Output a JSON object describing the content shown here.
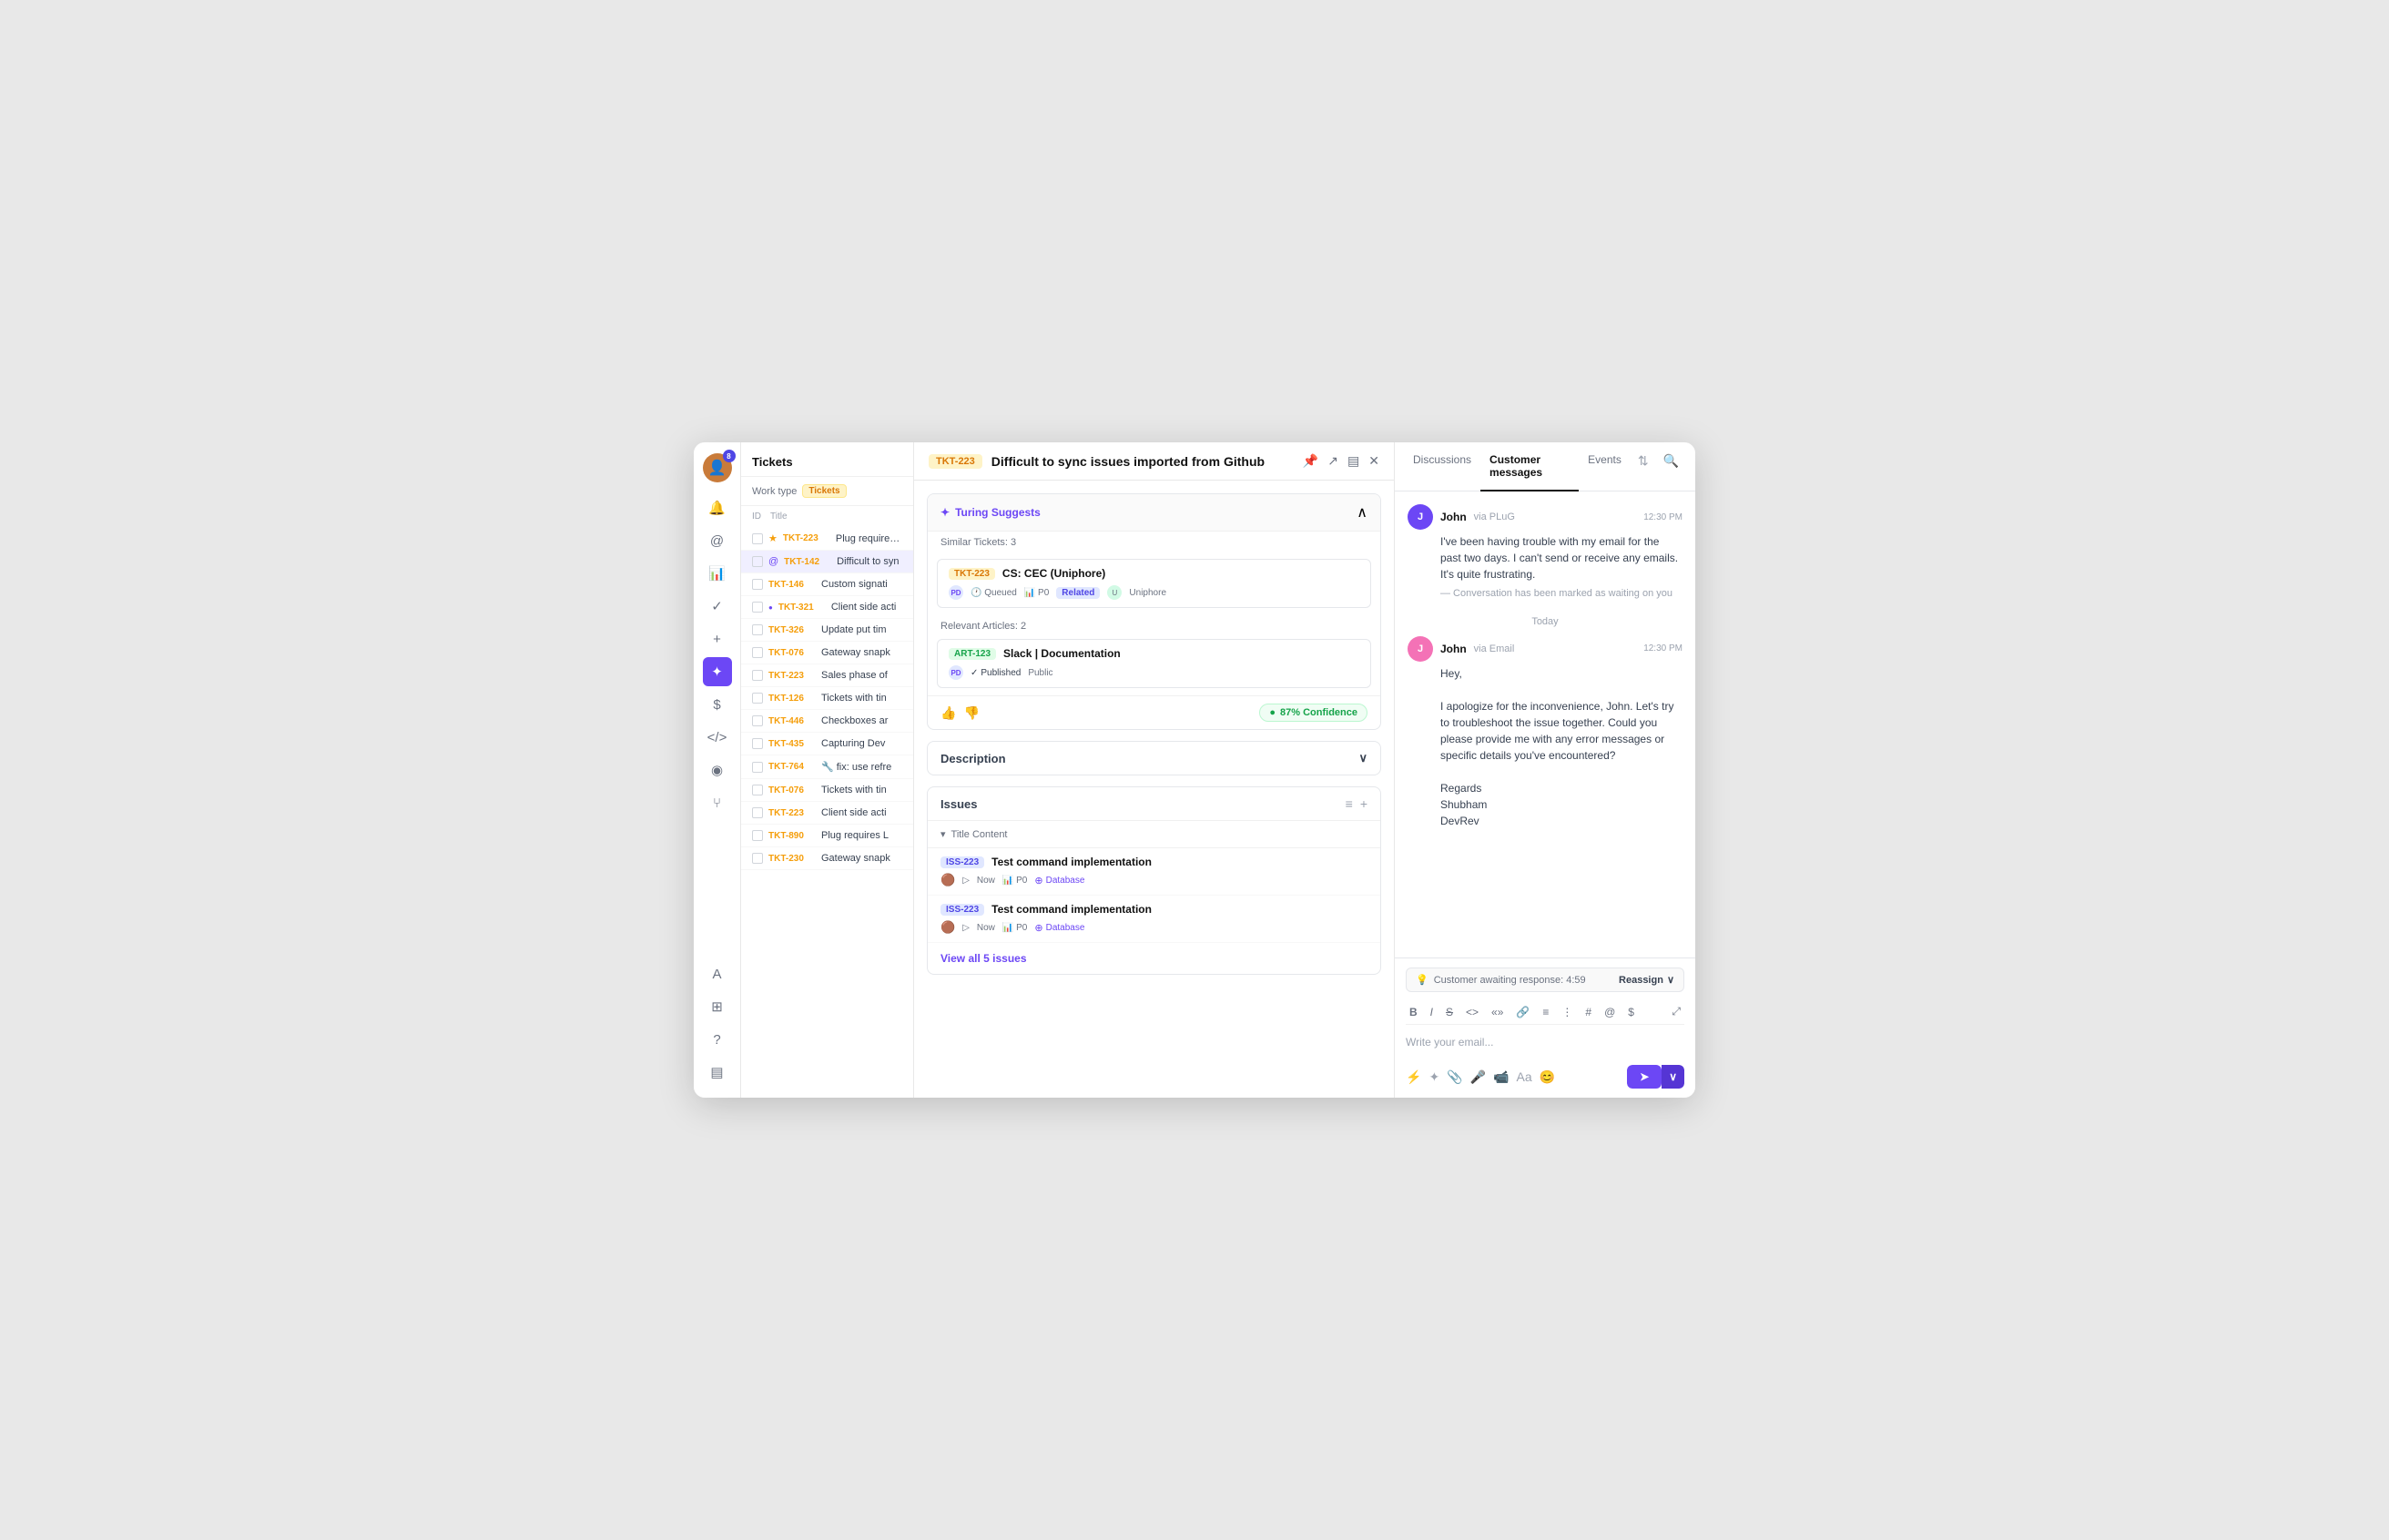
{
  "app": {
    "title": "Tickets"
  },
  "sidebar": {
    "badge": "8",
    "icons": [
      {
        "name": "at-icon",
        "symbol": "@"
      },
      {
        "name": "chart-icon",
        "symbol": "📊"
      },
      {
        "name": "check-icon",
        "symbol": "✓"
      },
      {
        "name": "plus-icon",
        "symbol": "+"
      },
      {
        "name": "star-icon",
        "symbol": "✦"
      },
      {
        "name": "dollar-icon",
        "symbol": "$"
      },
      {
        "name": "code-icon",
        "symbol": "</>"
      },
      {
        "name": "audio-icon",
        "symbol": "◉"
      },
      {
        "name": "branch-icon",
        "symbol": "⑂"
      },
      {
        "name": "font-icon",
        "symbol": "A"
      },
      {
        "name": "grid-icon",
        "symbol": "⊞"
      },
      {
        "name": "help-icon",
        "symbol": "?"
      },
      {
        "name": "layout-icon",
        "symbol": "▤"
      }
    ]
  },
  "tickets": {
    "header": "Tickets",
    "work_type_label": "Work type",
    "filter_badge": "Tickets",
    "columns": {
      "id": "ID",
      "title": "Title"
    },
    "list": [
      {
        "id": "TKT-223",
        "title": "Plug requires L",
        "has_star": true,
        "active": false
      },
      {
        "id": "TKT-142",
        "title": "Difficult to syn",
        "has_at": true,
        "active": true
      },
      {
        "id": "TKT-146",
        "title": "Custom signati",
        "active": false
      },
      {
        "id": "TKT-321",
        "title": "Client side acti",
        "has_dot": true,
        "active": false
      },
      {
        "id": "TKT-326",
        "title": "Update put tim",
        "active": false
      },
      {
        "id": "TKT-076",
        "title": "Gateway snapk",
        "active": false
      },
      {
        "id": "TKT-223",
        "title": "Sales phase of",
        "active": false
      },
      {
        "id": "TKT-126",
        "title": "Tickets with tin",
        "active": false
      },
      {
        "id": "TKT-446",
        "title": "Checkboxes ar",
        "active": false
      },
      {
        "id": "TKT-435",
        "title": "Capturing Dev",
        "active": false
      },
      {
        "id": "TKT-764",
        "title": "🔧 fix: use refre",
        "active": false
      },
      {
        "id": "TKT-076",
        "title": "Tickets with tin",
        "active": false
      },
      {
        "id": "TKT-223",
        "title": "Client side acti",
        "active": false
      },
      {
        "id": "TKT-890",
        "title": "Plug requires L",
        "active": false
      },
      {
        "id": "TKT-230",
        "title": "Gateway snapk",
        "active": false
      }
    ]
  },
  "main": {
    "ticket_tag": "TKT-223",
    "title": "Difficult to sync issues imported from Github",
    "turing": {
      "title": "Turing Suggests",
      "similar_label": "Similar Tickets: 3",
      "similar_tickets": [
        {
          "tag": "TKT-223",
          "title": "CS: CEC (Uniphore)",
          "avatar": "PD",
          "status": "Queued",
          "priority": "P0",
          "relation": "Related",
          "org": "Uniphore"
        }
      ],
      "articles_label": "Relevant Articles: 2",
      "articles": [
        {
          "tag": "ART-123",
          "title": "Slack | Documentation",
          "avatar": "PD",
          "published": "Published",
          "visibility": "Public"
        }
      ],
      "confidence": "87% Confidence"
    },
    "description_label": "Description",
    "issues": {
      "title": "Issues",
      "title_content": "Title Content",
      "list": [
        {
          "tag": "ISS-223",
          "title": "Test command implementation",
          "avatar": "🟤",
          "time": "Now",
          "priority": "P0",
          "category": "Database"
        },
        {
          "tag": "ISS-223",
          "title": "Test command implementation",
          "avatar": "🟤",
          "time": "Now",
          "priority": "P0",
          "category": "Database"
        }
      ],
      "view_all": "View all 5 issues"
    }
  },
  "right_panel": {
    "tabs": [
      {
        "label": "Discussions",
        "active": false
      },
      {
        "label": "Customer messages",
        "active": true
      },
      {
        "label": "Events",
        "active": false
      }
    ],
    "messages": [
      {
        "name": "John",
        "via": "via PLuG",
        "time": "12:30 PM",
        "avatar_color": "#6c47f5",
        "body": "I've been having trouble with my email for the past two days. I can't send or receive any emails. It's quite frustrating.",
        "note": "— Conversation has been marked as waiting on you"
      }
    ],
    "today_divider": "Today",
    "email_message": {
      "name": "John",
      "via": "via Email",
      "time": "12:30 PM",
      "avatar_color": "#f472b6",
      "greeting": "Hey,",
      "body": "I apologize for the inconvenience, John. Let's try to troubleshoot the issue together. Could you please provide me with any error messages or specific details you've encountered?",
      "sign_regards": "Regards",
      "sign_name": "Shubham",
      "sign_company": "DevRev"
    },
    "compose": {
      "status": "Customer awaiting response: 4:59",
      "reassign": "Reassign",
      "placeholder": "Write your email...",
      "toolbar": [
        "B",
        "I",
        "S",
        "<>",
        "«»",
        "🔗",
        "≡",
        "⋮",
        "#",
        "@",
        "$"
      ],
      "send_label": "Send"
    }
  }
}
